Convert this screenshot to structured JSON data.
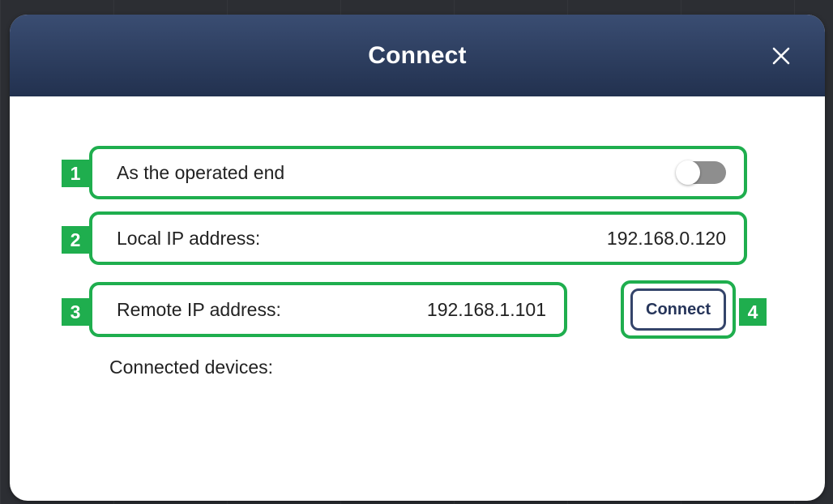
{
  "dialog": {
    "title": "Connect",
    "close_icon": "close-icon"
  },
  "rows": {
    "operated_end": {
      "badge": "1",
      "label": "As the operated end",
      "toggle_on": false
    },
    "local_ip": {
      "badge": "2",
      "label": "Local IP address:",
      "value": "192.168.0.120"
    },
    "remote_ip": {
      "badge": "3",
      "label": "Remote IP address:",
      "value": "192.168.1.101"
    }
  },
  "connect": {
    "badge": "4",
    "label": "Connect"
  },
  "connected_devices": {
    "label": "Connected devices:"
  },
  "colors": {
    "header_top": "#3a4d72",
    "header_bottom": "#22314f",
    "highlight_green": "#1fae4e",
    "toggle_off": "#8e8e8e"
  }
}
